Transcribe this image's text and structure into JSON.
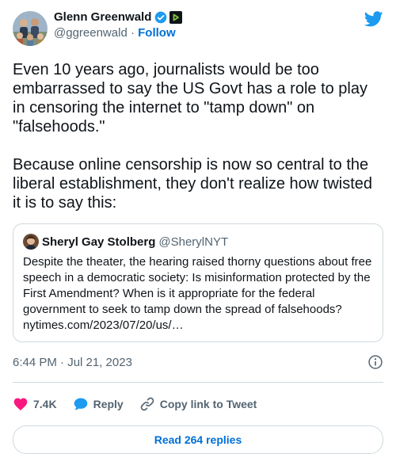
{
  "author": {
    "name": "Glenn Greenwald",
    "handle": "@ggreenwald",
    "separator": "·",
    "follow_label": "Follow"
  },
  "tweet": {
    "text": "Even 10 years ago, journalists would be too embarrassed to say the US Govt has a role to play in censoring the internet to \"tamp down\" on \"falsehoods.\"\n\nBecause online censorship is now so central to the liberal establishment, they don't realize how twisted it is to say this:",
    "timestamp": "6:44 PM · Jul 21, 2023"
  },
  "quote": {
    "name": "Sheryl Gay Stolberg",
    "handle": "@SherylNYT",
    "text": "Despite the theater, the hearing raised thorny questions about free speech in a democratic society: Is misinformation protected by the First Amendment? When is it appropriate for the federal government to seek to tamp down the spread of falsehoods? nytimes.com/2023/07/20/us/…"
  },
  "actions": {
    "likes_count": "7.4K",
    "reply_label": "Reply",
    "copy_link_label": "Copy link to Tweet"
  },
  "replies_label": "Read 264 replies",
  "colors": {
    "twitter_blue": "#1d9bf0",
    "link_blue": "#006fd6",
    "heart_red": "#f91880",
    "muted_text": "#536471",
    "border": "#cfd9de"
  },
  "icons": {
    "bird": "twitter-bird-icon",
    "verified": "verified-badge-icon",
    "affiliation": "rumble-affiliate-icon",
    "info": "info-icon",
    "like": "heart-icon",
    "reply": "speech-bubble-icon",
    "copy_link": "link-icon"
  }
}
